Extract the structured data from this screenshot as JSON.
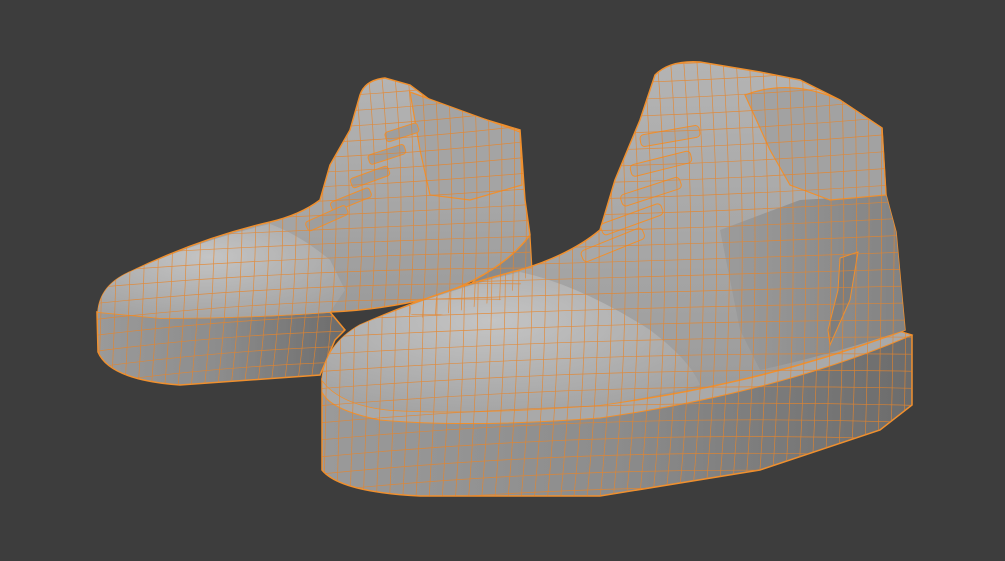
{
  "viewport": {
    "background": "#3d3d3d",
    "shading": "solid",
    "overlay": "wireframe",
    "selection_outline_color": "#f0902e",
    "wire_color": "#e8852a",
    "mesh_base_color": "#a7a7a7",
    "mesh_shadow_color": "#6f6f6f",
    "mesh_highlight_color": "#c2c2c2"
  },
  "objects": [
    {
      "name": "sneaker-left",
      "selected": true,
      "mode": "edit"
    },
    {
      "name": "sneaker-right",
      "selected": true,
      "mode": "edit"
    }
  ]
}
